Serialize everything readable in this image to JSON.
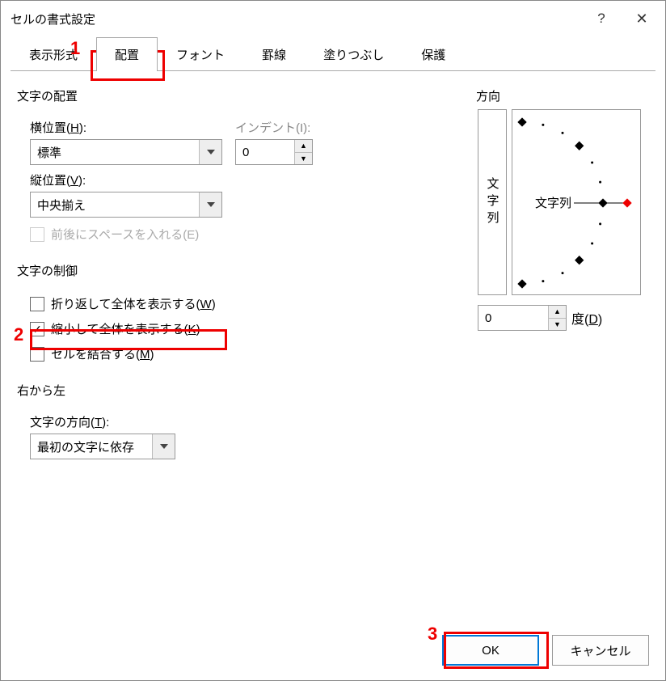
{
  "dialog": {
    "title": "セルの書式設定"
  },
  "titlebar": {
    "help": "?",
    "close": "✕"
  },
  "tabs": [
    "表示形式",
    "配置",
    "フォント",
    "罫線",
    "塗りつぶし",
    "保護"
  ],
  "active_tab": 1,
  "sections": {
    "alignment": "文字の配置",
    "control": "文字の制御",
    "rtl": "右から左",
    "orientation": "方向"
  },
  "labels": {
    "horizontal": "横位置(",
    "horizontal_u": "H",
    "vertical": "縦位置(",
    "vertical_u": "V",
    "indent": "インデント(",
    "indent_u": "I",
    "direction": "文字の方向(",
    "direction_u": "T",
    "degree": "度(",
    "degree_u": "D",
    "close_paren": "):"
  },
  "values": {
    "horizontal": "標準",
    "vertical": "中央揃え",
    "indent": "0",
    "direction": "最初の文字に依存",
    "degree": "0",
    "orientation_vert": "文字列",
    "orientation_dial": "文字列"
  },
  "checkboxes": {
    "space": "前後にスペースを入れる(E)",
    "wrap_pre": "折り返して全体を表示する(",
    "wrap_u": "W",
    "shrink_pre": "縮小して全体を表示する(",
    "shrink_u": "K",
    "merge_pre": "セルを結合する(",
    "merge_u": "M",
    "paren": ")"
  },
  "buttons": {
    "ok": "OK",
    "cancel": "キャンセル"
  },
  "annotations": {
    "n1": "1",
    "n2": "2",
    "n3": "3"
  }
}
